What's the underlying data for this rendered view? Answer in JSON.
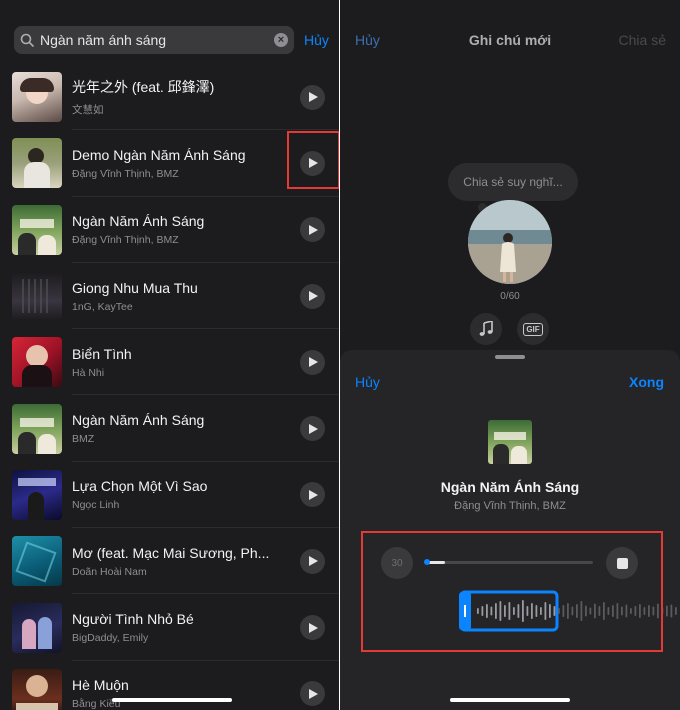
{
  "search": {
    "query": "Ngàn năm ánh sáng",
    "cancel": "Hủy"
  },
  "songs": [
    {
      "title": "光年之外 (feat. 邱鋒澤)",
      "artist": "文慧如"
    },
    {
      "title": "Demo Ngàn Năm Ánh Sáng",
      "artist": "Đặng Vĩnh Thịnh, BMZ"
    },
    {
      "title": "Ngàn Năm Ánh Sáng",
      "artist": "Đặng Vĩnh Thịnh, BMZ"
    },
    {
      "title": "Giong Nhu Mua Thu",
      "artist": "1nG, KayTee"
    },
    {
      "title": "Biển Tình",
      "artist": "Hà Nhi"
    },
    {
      "title": "Ngàn Năm Ánh Sáng",
      "artist": "BMZ"
    },
    {
      "title": "Lựa Chọn Một Vì Sao",
      "artist": "Ngọc Linh"
    },
    {
      "title": "Mơ (feat. Mạc Mai Sương, Ph...",
      "artist": "Doãn Hoài Nam"
    },
    {
      "title": "Người Tình Nhỏ Bé",
      "artist": "BigDaddy, Emily"
    },
    {
      "title": "Hè Muộn",
      "artist": "Bằng Kiều"
    }
  ],
  "note": {
    "cancel": "Hủy",
    "title": "Ghi chú mới",
    "share": "Chia sẻ",
    "placeholder": "Chia sẻ suy nghĩ...",
    "counter": "0/60",
    "gif": "GIF",
    "music_icon": "music-note-icon"
  },
  "sheet": {
    "cancel": "Hủy",
    "done": "Xong",
    "song_title": "Ngàn Năm Ánh Sáng",
    "song_artist": "Đặng Vĩnh Thịnh, BMZ",
    "duration": "30",
    "progress": 0.12
  },
  "colors": {
    "accent": "#0a84ff",
    "highlight": "#e53935",
    "background": "#1c1c1e"
  }
}
